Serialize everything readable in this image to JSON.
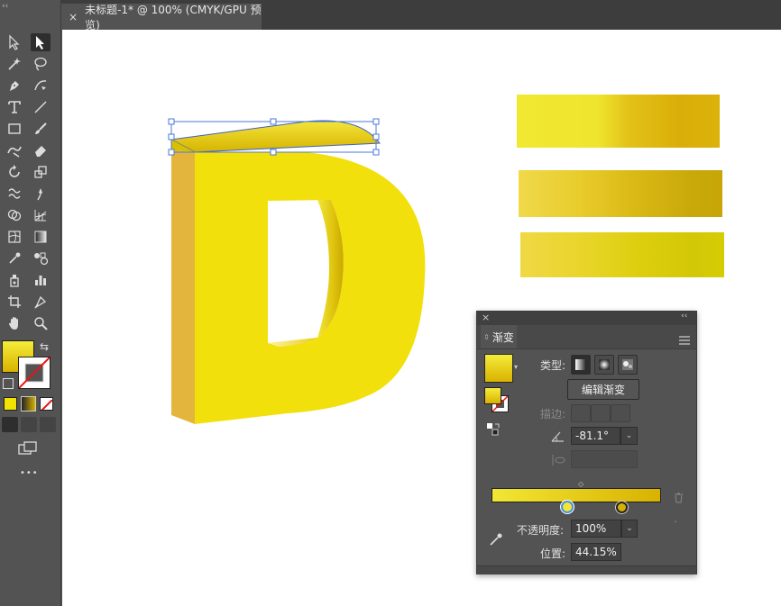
{
  "document_tab": {
    "close": "×",
    "title": "未标题-1* @ 100% (CMYK/GPU 预览)"
  },
  "toolbar": {
    "collapse": "‹‹",
    "more": "•••"
  },
  "canvas": {
    "letter": "D",
    "bars": [
      {
        "stops": [
          "#f1e831",
          "#efe42e",
          "#e3c218",
          "#d9ae08",
          "#dbb20a"
        ]
      },
      {
        "stops": [
          "#f0d94a",
          "#e8cc2c",
          "#dbba16",
          "#c9a80a",
          "#c8a607"
        ]
      },
      {
        "stops": [
          "#f0d845",
          "#e9d52a",
          "#dcce0d",
          "#d3c806",
          "#d6cc04"
        ]
      }
    ]
  },
  "gradient_panel": {
    "close": "×",
    "collapse": "‹‹",
    "tab_label": "渐变",
    "menu_icon": "hamburger-icon",
    "type_label": "类型:",
    "edit_button": "编辑渐变",
    "stroke_label": "描边:",
    "angle_value": "-81.1°",
    "opacity_label": "不透明度:",
    "opacity_value": "100%",
    "position_label": "位置:",
    "position_value": "44.15%",
    "gradient_stops": [
      "#f2e634",
      "#d9b200"
    ],
    "colors": {
      "fill": "#e8d210",
      "accent": "#4a90e2"
    }
  }
}
